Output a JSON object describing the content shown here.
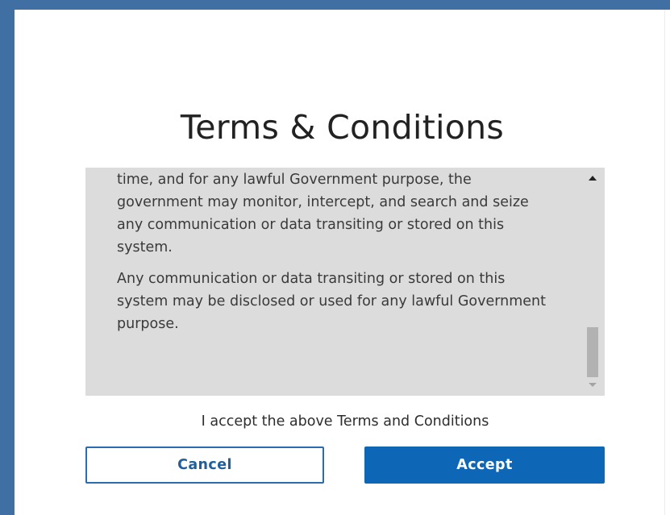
{
  "dialog": {
    "title": "Terms & Conditions",
    "terms": {
      "paragraphs": [
        "time, and for any lawful Government purpose, the government may monitor, intercept, and search and seize any communication or data transiting or stored on this system.",
        "Any communication or data transiting or stored on this system may be disclosed or used for any lawful Government purpose."
      ],
      "scroll_position": 0.85
    },
    "acceptance_text": "I accept the above Terms and Conditions",
    "buttons": {
      "cancel_label": "Cancel",
      "accept_label": "Accept"
    },
    "colors": {
      "frame": "#3f6fa3",
      "terms_background": "#dcdcdc",
      "primary": "#0e67b6",
      "outline": "#2b6bb0"
    }
  }
}
